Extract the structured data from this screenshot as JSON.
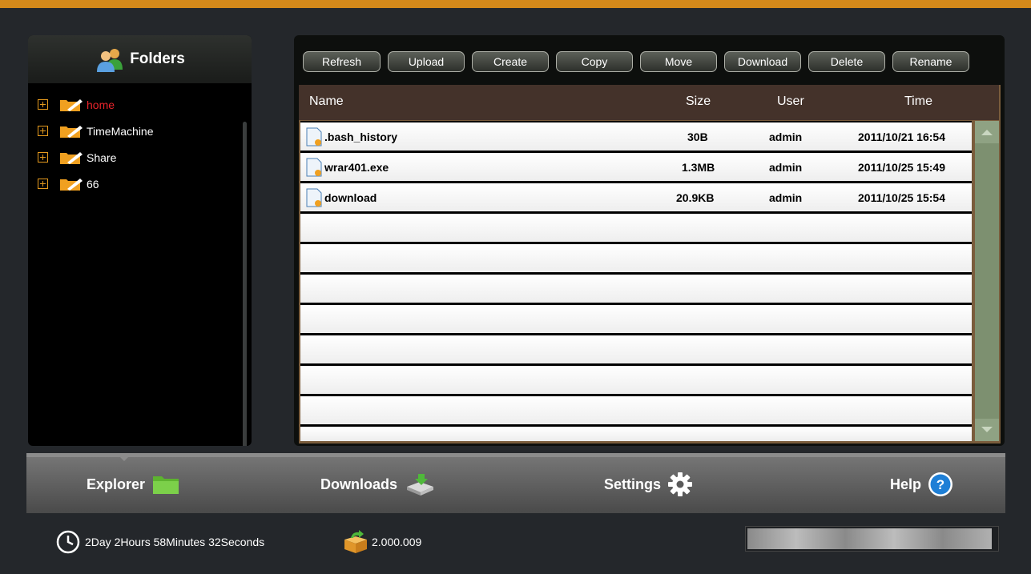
{
  "folders": {
    "title": "Folders",
    "items": [
      {
        "label": "home",
        "active": true
      },
      {
        "label": "TimeMachine",
        "active": false
      },
      {
        "label": "Share",
        "active": false
      },
      {
        "label": "66",
        "active": false
      }
    ]
  },
  "toolbar": {
    "buttons": [
      "Refresh",
      "Upload",
      "Create",
      "Copy",
      "Move",
      "Download",
      "Delete",
      "Rename"
    ]
  },
  "table": {
    "columns": {
      "name": "Name",
      "size": "Size",
      "user": "User",
      "time": "Time"
    },
    "rows": [
      {
        "name": ".bash_history",
        "size": "30B",
        "user": "admin",
        "time": "2011/10/21 16:54"
      },
      {
        "name": "wrar401.exe",
        "size": "1.3MB",
        "user": "admin",
        "time": "2011/10/25 15:49"
      },
      {
        "name": "download",
        "size": "20.9KB",
        "user": "admin",
        "time": "2011/10/25 15:54"
      }
    ]
  },
  "nav": {
    "explorer": "Explorer",
    "downloads": "Downloads",
    "settings": "Settings",
    "help": "Help"
  },
  "status": {
    "uptime": "2Day 2Hours 58Minutes 32Seconds",
    "version": "2.000.009",
    "progress_fraction": 0.98
  },
  "icons": {
    "users": "users-icon",
    "folder": "folder-icon",
    "file": "file-icon",
    "clock": "clock-icon",
    "box": "box-icon",
    "gear": "gear-icon",
    "help": "help-icon"
  },
  "colors": {
    "accent": "#d4891a",
    "active_folder": "#e8242b",
    "help_blue": "#1e7fd6"
  }
}
